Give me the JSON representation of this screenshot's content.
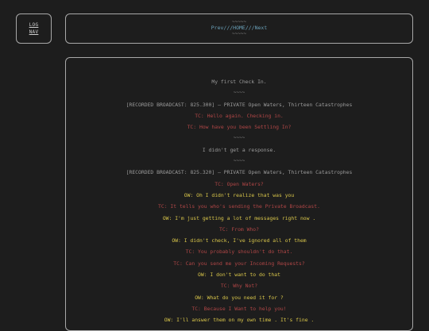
{
  "log_button": {
    "label": "LOG\nNAV"
  },
  "nav": {
    "prev": "Prev",
    "sep1": "///",
    "home": "HOME",
    "sep2": "///",
    "next": "Next",
    "divider": "~~~~~"
  },
  "lines": [
    {
      "speaker": "sys",
      "text": "My first Check In."
    },
    {
      "speaker": "div",
      "text": "~~~~"
    },
    {
      "speaker": "sys",
      "text": "[RECORDED BROADCAST: 825.300] – PRIVATE Open Waters, Thirteen Catastrophes"
    },
    {
      "speaker": "tc",
      "text": "TC: Hello again. Checking in."
    },
    {
      "speaker": "tc",
      "text": "TC: How have you been Settling In?"
    },
    {
      "speaker": "div",
      "text": "~~~~"
    },
    {
      "speaker": "sys",
      "text": "I didn't get a response."
    },
    {
      "speaker": "div",
      "text": "~~~~"
    },
    {
      "speaker": "sys",
      "text": "[RECORDED BROADCAST: 825.320] – PRIVATE Open Waters, Thirteen Catastrophes"
    },
    {
      "speaker": "tc",
      "text": "TC: Open Waters?"
    },
    {
      "speaker": "ow",
      "text": "OW: Oh I didn't realize that was you"
    },
    {
      "speaker": "tc",
      "text": "TC: It tells you who's sending the Private Broadcast."
    },
    {
      "speaker": "ow",
      "text": "OW: I'm just getting a lot of messages right now ."
    },
    {
      "speaker": "tc",
      "text": "TC: From Who?"
    },
    {
      "speaker": "ow",
      "text": "OW: I didn't check, I've ignored all of them"
    },
    {
      "speaker": "tc",
      "text": "TC: You probably shouldn't do that."
    },
    {
      "speaker": "tc",
      "text": "TC: Can you send me your Incoming Requests?"
    },
    {
      "speaker": "ow",
      "text": "OW: I don't want to do that"
    },
    {
      "speaker": "tc",
      "text": "TC: Why Not?"
    },
    {
      "speaker": "ow",
      "text": "OW: What do you need it for ?"
    },
    {
      "speaker": "tc",
      "text": "TC: Because I Want to help you!"
    },
    {
      "speaker": "ow",
      "text": "OW: I'll answer them on my own time . It's fine ."
    }
  ]
}
